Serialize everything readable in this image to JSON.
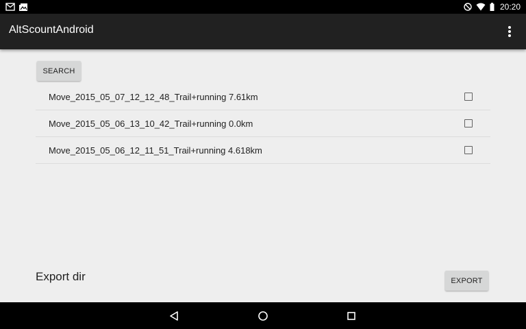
{
  "status_bar": {
    "time": "20:20",
    "left_icons": [
      "gmail-notification-icon",
      "photo-notification-icon"
    ],
    "right_icons": [
      "do-not-disturb-icon",
      "wifi-icon",
      "battery-icon"
    ]
  },
  "app_bar": {
    "title": "AltScountAndroid",
    "overflow_icon": "more-vert-icon"
  },
  "search": {
    "label": "SEARCH"
  },
  "moves": [
    {
      "label": "Move_2015_05_07_12_12_48_Trail+running 7.61km",
      "checked": false
    },
    {
      "label": "Move_2015_05_06_13_10_42_Trail+running 0.0km",
      "checked": false
    },
    {
      "label": "Move_2015_05_06_12_11_51_Trail+running 4.618km",
      "checked": false
    }
  ],
  "export": {
    "dir_label": "Export dir",
    "button_label": "EXPORT"
  },
  "nav_bar": {
    "icons": [
      "back-icon",
      "home-icon",
      "recents-icon"
    ]
  },
  "colors": {
    "app_bar": "#212121",
    "background": "#eeeeee",
    "button": "#d6d7d7",
    "status_bar": "#000000"
  }
}
